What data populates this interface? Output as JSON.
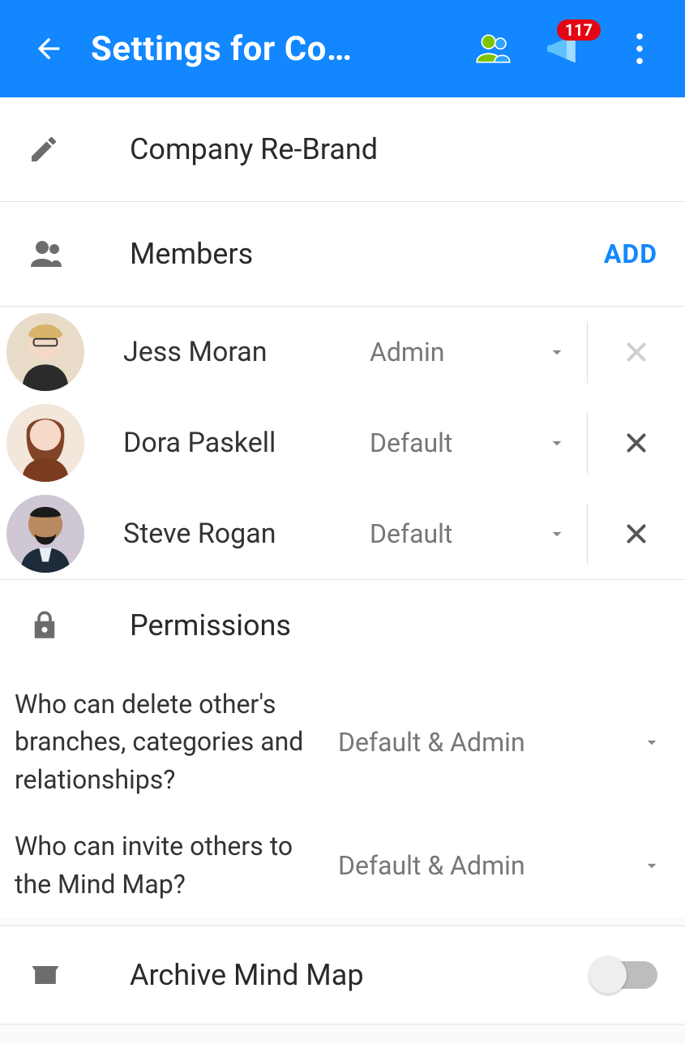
{
  "header": {
    "title": "Settings for Co…",
    "notification_count": "117"
  },
  "name_section": {
    "value": "Company Re-Brand"
  },
  "members_section": {
    "label": "Members",
    "add_label": "ADD",
    "members": [
      {
        "name": "Jess Moran",
        "role": "Admin",
        "removable": false
      },
      {
        "name": "Dora Paskell",
        "role": "Default",
        "removable": true
      },
      {
        "name": "Steve Rogan",
        "role": "Default",
        "removable": true
      }
    ]
  },
  "permissions_section": {
    "label": "Permissions",
    "items": [
      {
        "question": "Who can delete other's branches, categories and relationships?",
        "value": "Default & Admin"
      },
      {
        "question": "Who can invite others to the Mind Map?",
        "value": "Default & Admin"
      }
    ]
  },
  "archive_section": {
    "label": "Archive Mind Map",
    "enabled": false
  },
  "colors": {
    "accent": "#1287ff",
    "badge": "#e30613"
  }
}
